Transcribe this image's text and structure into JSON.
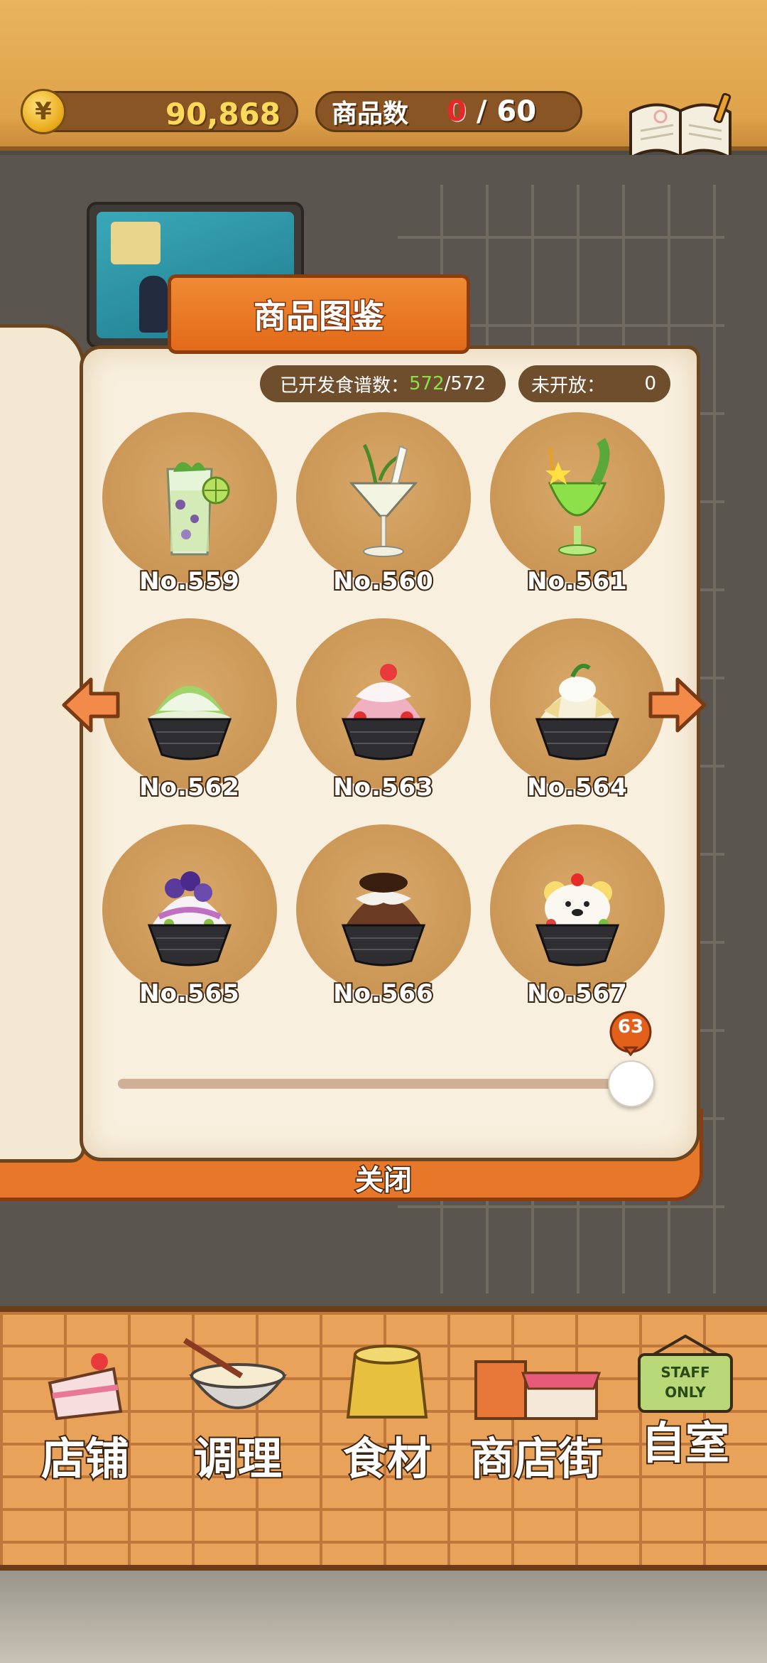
{
  "header": {
    "money_symbol": "¥",
    "money": "90,868",
    "product_count_label": "商品数",
    "product_count_owned": "0",
    "product_count_total": "/ 60",
    "recipe_label": "食谱"
  },
  "book": {
    "title": "商品图鉴",
    "developed_label": "已开发食谱数：",
    "developed_count": "572",
    "developed_total": "/572",
    "unopened_label": "未开放：",
    "unopened_count": "0",
    "items": [
      {
        "label": "No.559",
        "kind": "drink",
        "name": "mojito"
      },
      {
        "label": "No.560",
        "kind": "cocktail",
        "name": "martini"
      },
      {
        "label": "No.561",
        "kind": "soda",
        "name": "melon-soda"
      },
      {
        "label": "No.562",
        "kind": "shaved-ice",
        "name": "matcha-shaved-ice"
      },
      {
        "label": "No.563",
        "kind": "shaved-ice",
        "name": "strawberry-shaved-ice"
      },
      {
        "label": "No.564",
        "kind": "shaved-ice",
        "name": "mango-shaved-ice"
      },
      {
        "label": "No.565",
        "kind": "shaved-ice",
        "name": "berry-shaved-ice"
      },
      {
        "label": "No.566",
        "kind": "shaved-ice",
        "name": "chocolate-shaved-ice"
      },
      {
        "label": "No.567",
        "kind": "shaved-ice",
        "name": "bear-shaved-ice"
      }
    ],
    "page_slider_value": "63",
    "close_label": "关闭"
  },
  "nav": {
    "shop": "店铺",
    "cook": "调理",
    "food": "食材",
    "street": "商店街",
    "room": "自室",
    "staff_sign": "STAFF ONLY"
  },
  "colors": {
    "accent_orange": "#e26a18",
    "pill_brown": "#6f4e2e",
    "developed_green": "#8ae04a",
    "owned_red": "#e82828"
  }
}
